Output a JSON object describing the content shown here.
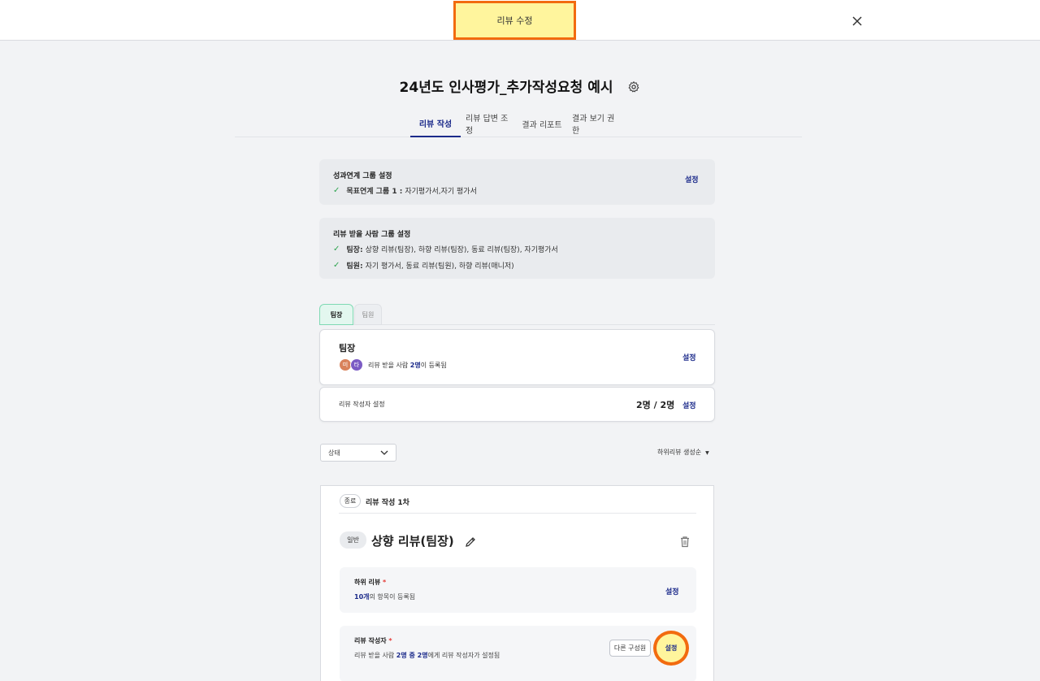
{
  "header": {
    "title": "리뷰 수정",
    "close_icon": "close-icon"
  },
  "page": {
    "title": "24년도 인사평가_추가작성요청 예시",
    "settings_icon": "gear-icon"
  },
  "tabs": [
    {
      "label": "리뷰 작성",
      "active": true
    },
    {
      "label": "리뷰 답변 조정"
    },
    {
      "label": "결과 리포트"
    },
    {
      "label": "결과 보기 권한"
    }
  ],
  "performance_group": {
    "title": "성과연계 그룹 설정",
    "set_label": "설정",
    "items": [
      {
        "bold": "목표연계 그룹 1 :",
        "text": "자기평가서,자기 평가서"
      }
    ]
  },
  "reviewee_group": {
    "title": "리뷰 받을 사람 그룹 설정",
    "items": [
      {
        "bold": "팀장:",
        "text": "상향 리뷰(팀장), 하향 리뷰(팀장), 동료 리뷰(팀장), 자기평가서"
      },
      {
        "bold": "팀원:",
        "text": "자기 평가서, 동료 리뷰(팀원), 하향 리뷰(매니저)"
      }
    ]
  },
  "sub_tabs": [
    {
      "label": "팀장",
      "active": true
    },
    {
      "label": "팀원"
    }
  ],
  "leader_card": {
    "title": "팀장",
    "avatars": [
      {
        "initial": "미",
        "color": "#d9825b"
      },
      {
        "initial": "타",
        "color": "#7c5cc4"
      }
    ],
    "registered_prefix": "리뷰 받을 사람 ",
    "registered_count": "2명",
    "registered_suffix": "이 등록됨",
    "set_label": "설정"
  },
  "writer_card": {
    "label": "리뷰 작성자 설정",
    "count": "2명 / 2명",
    "set_label": "설정"
  },
  "filter": {
    "status_label": "상태",
    "sort_label": "하위리뷰 생성순"
  },
  "round": {
    "status_badge": "종료",
    "title": "리뷰 작성 1차",
    "type_badge": "일반",
    "review_title": "상향 리뷰(팀장)",
    "sub_review": {
      "label": "하위 리뷰",
      "required_mark": "*",
      "count": "10개",
      "desc_suffix": "의 항목이 등록됨",
      "set_label": "설정"
    },
    "writers": {
      "label": "리뷰 작성자",
      "required_mark": "*",
      "desc_prefix": "리뷰 받을 사람 ",
      "desc_highlight": "2명 중 2명",
      "desc_suffix": "에게 리뷰 작성자가 설정됨",
      "other_member_label": "다른 구성원",
      "set_label": "설정"
    }
  }
}
